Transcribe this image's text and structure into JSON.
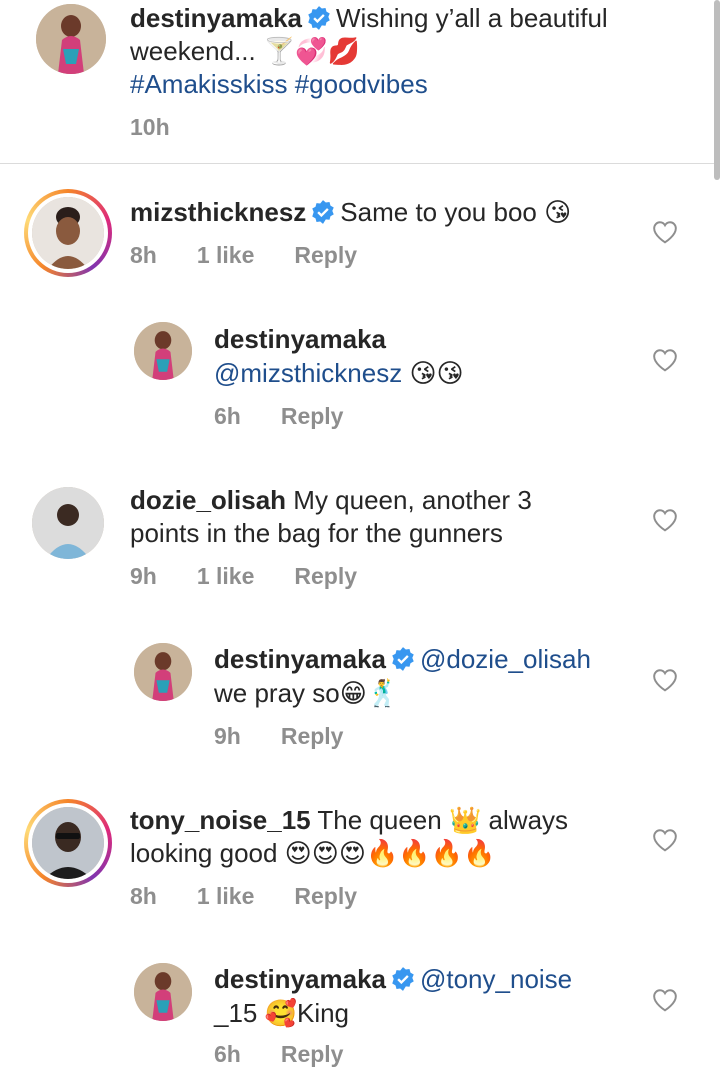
{
  "caption": {
    "username": "destinyamaka",
    "line1": "Wishing y’all a beautiful",
    "line2": "weekend... 🍸💞💋",
    "hashtags": "#Amakisskiss #goodvibes",
    "time": "10h"
  },
  "comments": [
    {
      "username": "mizsthicknesz",
      "verified": true,
      "text_line1": "Same to you boo 😘",
      "text_line2": "",
      "time": "8h",
      "likes": "1 like",
      "reply_label": "Reply",
      "avatar_style": "woman-portrait",
      "has_story_ring": true
    },
    {
      "username": "destinyamaka",
      "verified": false,
      "mention": "@mizsthicknesz",
      "text_line1": "😘😘",
      "time": "6h",
      "reply_label": "Reply"
    },
    {
      "username": "dozie_olisah",
      "verified": false,
      "text_line1": "My queen, another 3",
      "text_line2": "points in the bag for the gunners",
      "time": "9h",
      "likes": "1 like",
      "reply_label": "Reply",
      "avatar_style": "man-portrait"
    },
    {
      "username": "destinyamaka",
      "verified": true,
      "mention": "@dozie_olisah",
      "text_line2": "we pray so😁🕺",
      "time": "9h",
      "reply_label": "Reply"
    },
    {
      "username": "tony_noise_15",
      "verified": false,
      "text_line1": "The queen 👑 always",
      "text_line2": "looking good 😍😍😍🔥🔥🔥🔥",
      "time": "8h",
      "likes": "1 like",
      "reply_label": "Reply",
      "avatar_style": "man-glasses",
      "has_story_ring": true
    },
    {
      "username": "destinyamaka",
      "verified": true,
      "mention": "@tony_noise",
      "text_line2": "_15 🥰King",
      "time": "6h",
      "reply_label": "Reply"
    }
  ],
  "colors": {
    "mention_blue": "#1f4e8c",
    "verified_blue": "#3897f0",
    "meta_gray": "#8e8e8e"
  },
  "icons": {
    "verified": "verified-badge-icon",
    "like": "heart-outline-icon"
  }
}
